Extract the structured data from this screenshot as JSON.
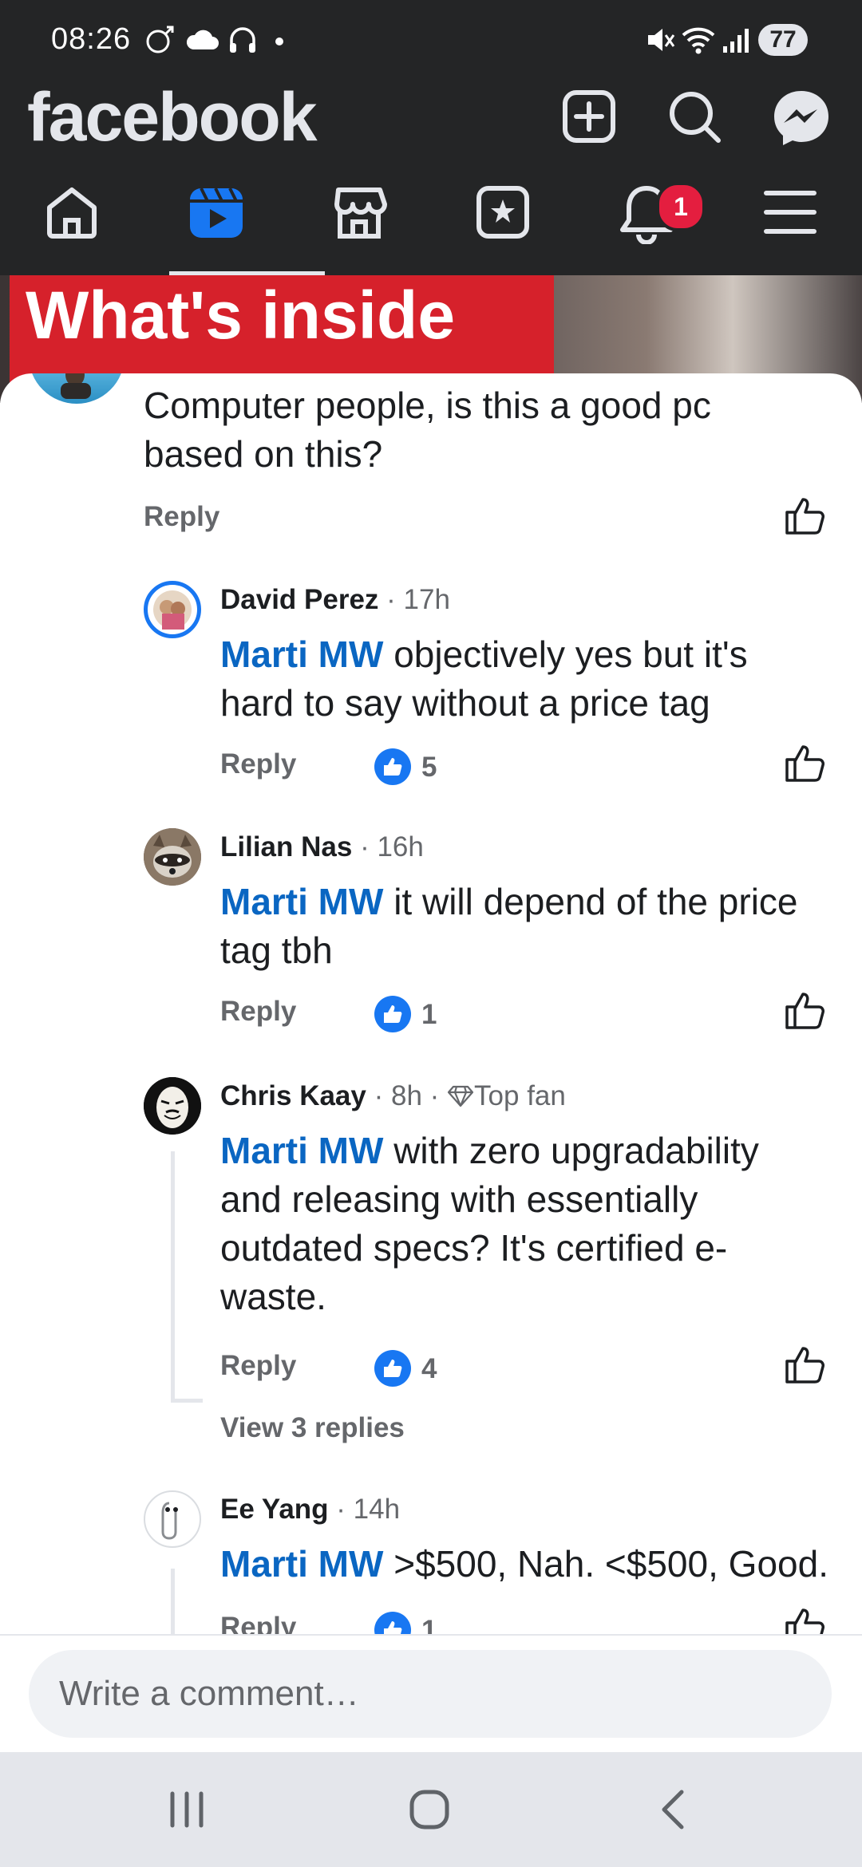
{
  "status_bar": {
    "time": "08:26",
    "battery": "77"
  },
  "header": {
    "brand": "facebook",
    "notification_count": "1"
  },
  "video": {
    "title_visible": "What's inside"
  },
  "comments": [
    {
      "text": "Computer people, is this a good pc based on this?",
      "reply_label": "Reply"
    },
    {
      "author": "David Perez",
      "time": "· 17h",
      "mention": "Marti MW",
      "text": " objectively yes but it's hard to say without a price tag",
      "reply_label": "Reply",
      "likes": "5"
    },
    {
      "author": "Lilian Nas",
      "time": "· 16h",
      "mention": "Marti MW",
      "text": " it will depend of the price tag tbh",
      "reply_label": "Reply",
      "likes": "1"
    },
    {
      "author": "Chris Kaay",
      "time": "· 8h ·",
      "badge": "Top fan",
      "mention": "Marti MW",
      "text": " with zero upgradability and releasing with essentially outdated specs? It's certified e-waste.",
      "reply_label": "Reply",
      "likes": "4",
      "view_replies": "View 3 replies"
    },
    {
      "author": "Ee Yang",
      "time": "· 14h",
      "mention": "Marti MW",
      "text": " >$500, Nah. <$500, Good.",
      "reply_label": "Reply",
      "likes": "1"
    }
  ],
  "composer": {
    "placeholder": "Write a comment…"
  },
  "colors": {
    "header_bg": "#242526",
    "mention": "#0a66c2",
    "like_blue": "#1877f2",
    "badge_red": "#e41e3f"
  }
}
